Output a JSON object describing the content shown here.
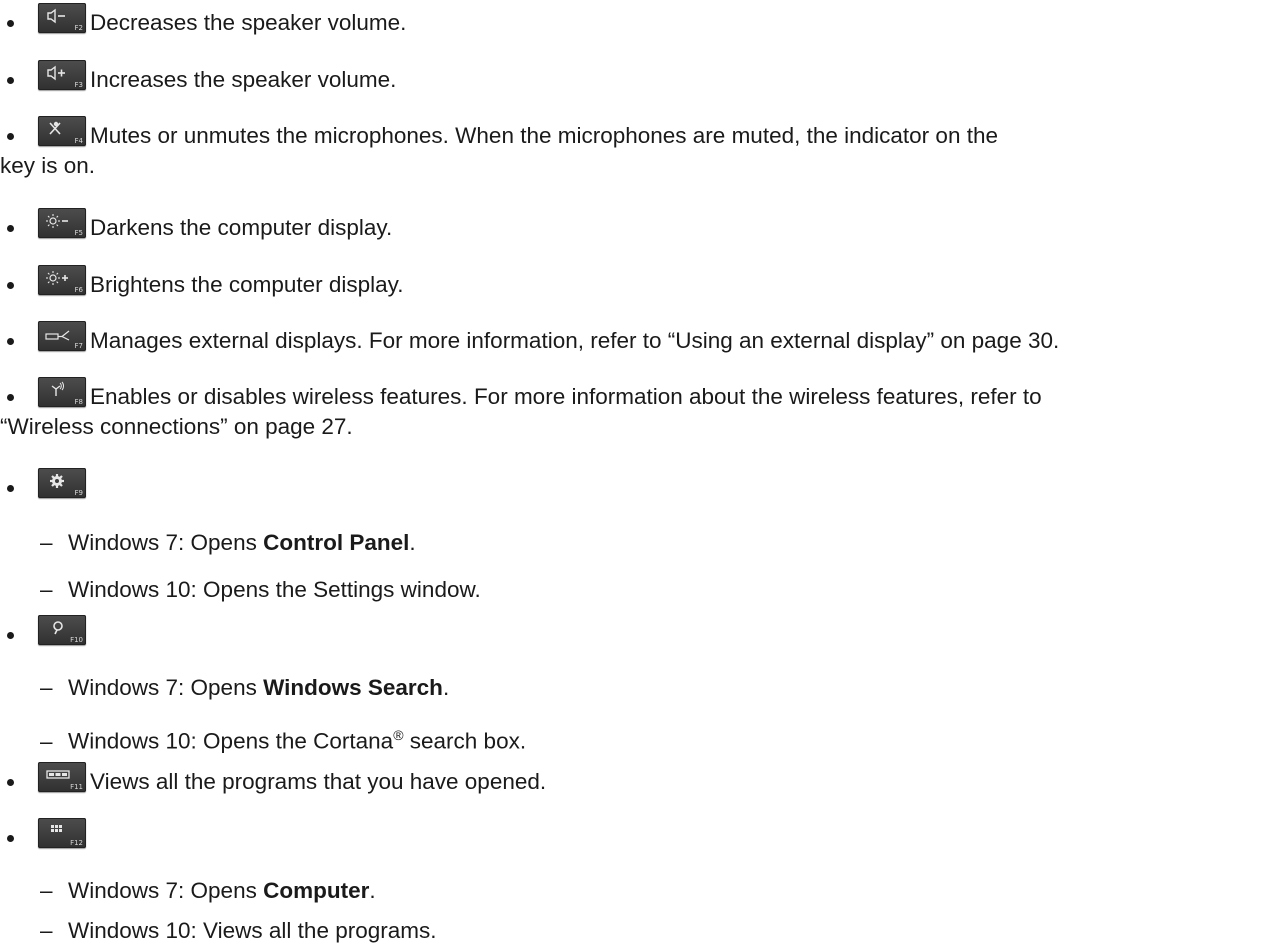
{
  "items": [
    {
      "key": "F2",
      "icon": "volume-down-icon",
      "text": "Decreases the speaker volume."
    },
    {
      "key": "F3",
      "icon": "volume-up-icon",
      "text": "Increases the speaker volume."
    },
    {
      "key": "F4",
      "icon": "microphone-mute-icon",
      "text": "Mutes or unmutes the microphones. When the microphones are muted, the indicator on the",
      "text2": "key is on."
    },
    {
      "key": "F5",
      "icon": "brightness-down-icon",
      "text": "Darkens the computer display."
    },
    {
      "key": "F6",
      "icon": "brightness-up-icon",
      "text": "Brightens the computer display."
    },
    {
      "key": "F7",
      "icon": "external-display-icon",
      "text": "Manages external displays. For more information, refer to “Using an external display” on page 30."
    },
    {
      "key": "F8",
      "icon": "wireless-icon",
      "text": "Enables or disables wireless features. For more information about the wireless features, refer to",
      "text2": "“Wireless connections” on page 27."
    },
    {
      "key": "F9",
      "icon": "settings-gear-icon",
      "sub": [
        {
          "prefix": "Windows 7: Opens ",
          "bold": "Control Panel",
          "suffix": "."
        },
        {
          "prefix": "Windows 10: Opens the Settings window.",
          "bold": "",
          "suffix": ""
        }
      ]
    },
    {
      "key": "F10",
      "icon": "search-icon",
      "sub": [
        {
          "prefix": "Windows 7: Opens ",
          "bold": "Windows Search",
          "suffix": "."
        },
        {
          "prefix": "Windows 10: Opens the Cortana",
          "sup": "®",
          "suffix": " search box."
        }
      ]
    },
    {
      "key": "F11",
      "icon": "task-view-icon",
      "text": "Views all the programs that you have opened."
    },
    {
      "key": "F12",
      "icon": "apps-grid-icon",
      "sub": [
        {
          "prefix": "Windows 7: Opens ",
          "bold": "Computer",
          "suffix": "."
        },
        {
          "prefix": "Windows 10: Views all the programs.",
          "bold": "",
          "suffix": ""
        }
      ]
    }
  ],
  "dash": "–",
  "colors": {
    "text": "#1a1a1a",
    "key_bg": "#3d3d3d",
    "key_glyph": "#e6e6e6"
  }
}
